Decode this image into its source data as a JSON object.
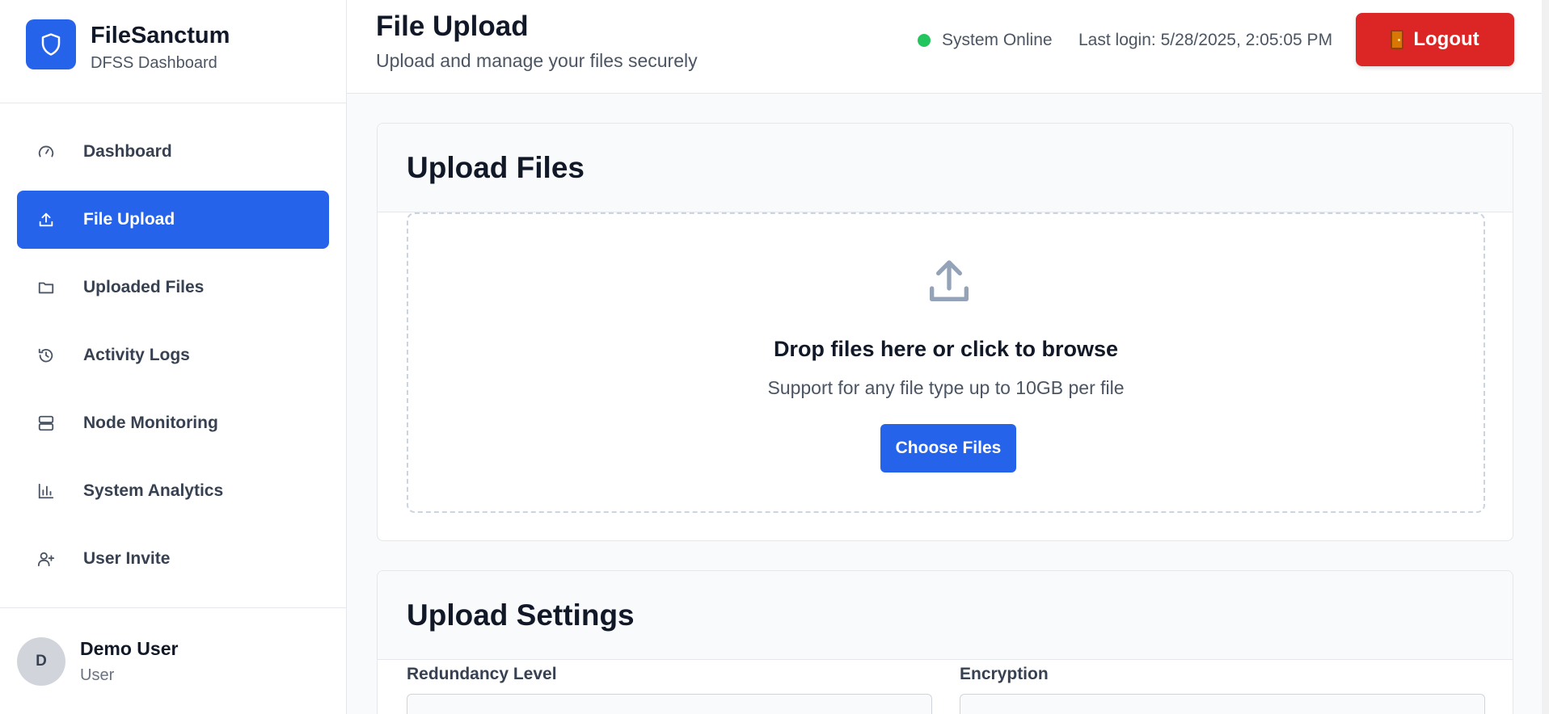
{
  "brand": {
    "title": "FileSanctum",
    "subtitle": "DFSS Dashboard"
  },
  "sidebar": {
    "items": [
      {
        "label": "Dashboard",
        "icon": "gauge-icon",
        "active": false
      },
      {
        "label": "File Upload",
        "icon": "upload-icon",
        "active": true
      },
      {
        "label": "Uploaded Files",
        "icon": "folder-icon",
        "active": false
      },
      {
        "label": "Activity Logs",
        "icon": "history-icon",
        "active": false
      },
      {
        "label": "Node Monitoring",
        "icon": "server-icon",
        "active": false
      },
      {
        "label": "System Analytics",
        "icon": "bar-chart-icon",
        "active": false
      },
      {
        "label": "User Invite",
        "icon": "user-plus-icon",
        "active": false
      }
    ]
  },
  "user": {
    "initial": "D",
    "name": "Demo User",
    "role": "User"
  },
  "header": {
    "title": "File Upload",
    "subtitle": "Upload and manage your files securely",
    "status": "System Online",
    "last_login": "Last login: 5/28/2025, 2:05:05 PM",
    "logout_label": "Logout"
  },
  "upload_card": {
    "title": "Upload Files",
    "drop_title": "Drop files here or click to browse",
    "drop_sub": "Support for any file type up to 10GB per file",
    "choose_label": "Choose Files"
  },
  "settings_card": {
    "title": "Upload Settings",
    "redundancy_label": "Redundancy Level",
    "encryption_label": "Encryption"
  },
  "colors": {
    "accent": "#2563eb",
    "danger": "#dc2626",
    "online": "#22c55e"
  }
}
